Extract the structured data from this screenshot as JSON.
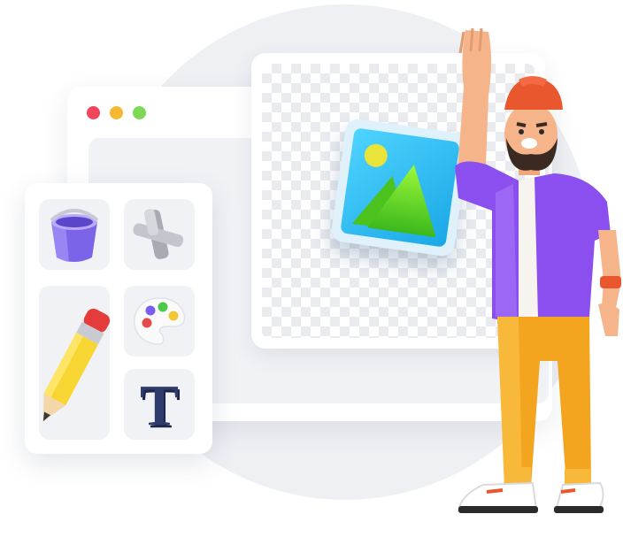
{
  "window": {
    "dots": [
      {
        "name": "close-dot",
        "color": "#f0455a"
      },
      {
        "name": "minimize-dot",
        "color": "#f7b731"
      },
      {
        "name": "maximize-dot",
        "color": "#7ed957"
      }
    ]
  },
  "tools": {
    "text_tool_glyph": "T",
    "icons": [
      "paint-bucket-icon",
      "cross-shape-icon",
      "pencil-icon",
      "palette-icon",
      "text-icon"
    ]
  },
  "canvas": {
    "image_icon": "landscape-image-icon"
  },
  "colors": {
    "accent_purple": "#8b4ff0",
    "image_blue": "#39c5f2",
    "mountain_green": "#5fd324",
    "sun_yellow": "#e9e43a"
  }
}
